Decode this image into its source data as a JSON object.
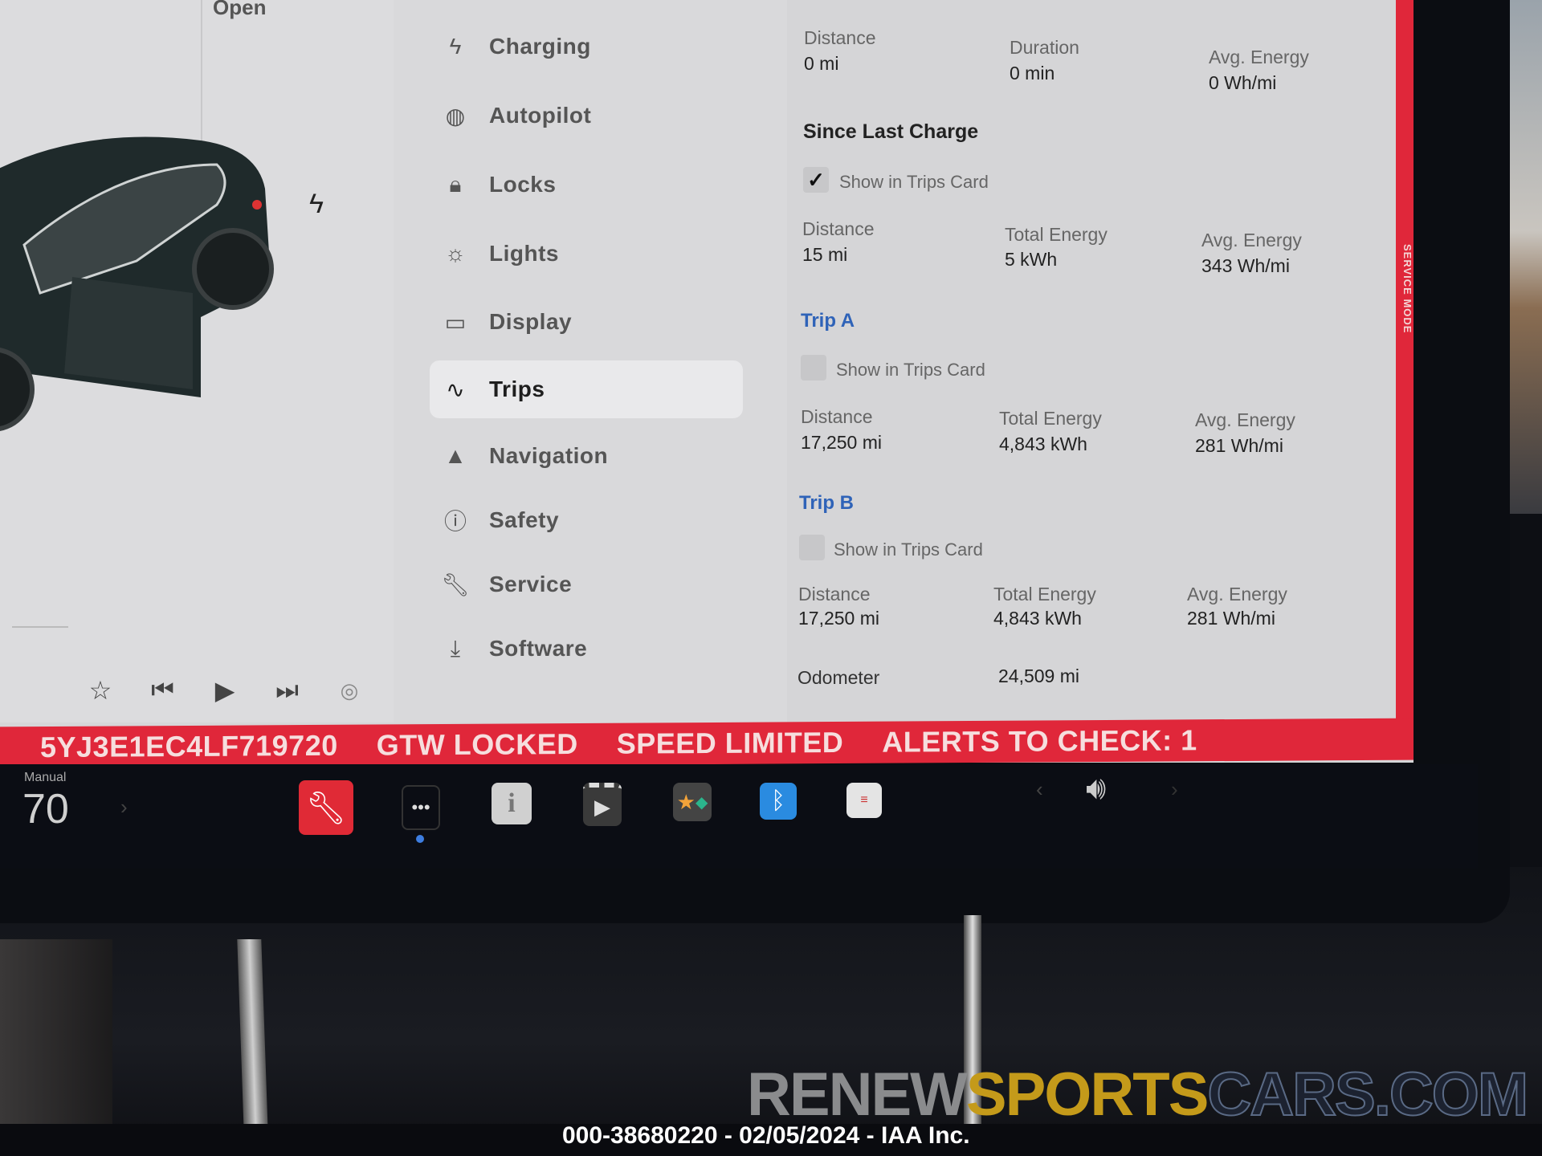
{
  "left_panel": {
    "status_label": "Open",
    "media_controls": [
      "favorite",
      "previous",
      "play",
      "next",
      "radio-source"
    ]
  },
  "sidebar": {
    "items": [
      {
        "label": "Charging",
        "icon": "bolt-icon",
        "active": false
      },
      {
        "label": "Autopilot",
        "icon": "steering-wheel-icon",
        "active": false
      },
      {
        "label": "Locks",
        "icon": "lock-icon",
        "active": false
      },
      {
        "label": "Lights",
        "icon": "light-bulb-icon",
        "active": false
      },
      {
        "label": "Display",
        "icon": "display-icon",
        "active": false
      },
      {
        "label": "Trips",
        "icon": "trips-icon",
        "active": true
      },
      {
        "label": "Navigation",
        "icon": "navigation-arrow-icon",
        "active": false
      },
      {
        "label": "Safety",
        "icon": "alert-circle-icon",
        "active": false
      },
      {
        "label": "Service",
        "icon": "wrench-icon",
        "active": false
      },
      {
        "label": "Software",
        "icon": "download-icon",
        "active": false
      }
    ]
  },
  "content": {
    "current_drive": {
      "cols": [
        {
          "label": "Distance",
          "value": "0 mi"
        },
        {
          "label": "Duration",
          "value": "0 min"
        },
        {
          "label": "Avg. Energy",
          "value": "0 Wh/mi"
        }
      ]
    },
    "since_last_charge": {
      "title": "Since Last Charge",
      "show_in_trips_card": {
        "label": "Show in Trips Card",
        "checked": true
      },
      "cols": [
        {
          "label": "Distance",
          "value": "15 mi"
        },
        {
          "label": "Total Energy",
          "value": "5 kWh"
        },
        {
          "label": "Avg. Energy",
          "value": "343 Wh/mi"
        }
      ]
    },
    "trip_a": {
      "title": "Trip A",
      "show_in_trips_card": {
        "label": "Show in Trips Card",
        "checked": false
      },
      "cols": [
        {
          "label": "Distance",
          "value": "17,250 mi"
        },
        {
          "label": "Total Energy",
          "value": "4,843 kWh"
        },
        {
          "label": "Avg. Energy",
          "value": "281 Wh/mi"
        }
      ]
    },
    "trip_b": {
      "title": "Trip B",
      "show_in_trips_card": {
        "label": "Show in Trips Card",
        "checked": false
      },
      "cols": [
        {
          "label": "Distance",
          "value": "17,250 mi"
        },
        {
          "label": "Total Energy",
          "value": "4,843 kWh"
        },
        {
          "label": "Avg. Energy",
          "value": "281 Wh/mi"
        }
      ]
    },
    "odometer": {
      "label": "Odometer",
      "value": "24,509 mi"
    }
  },
  "service_mode": {
    "side_label": "SERVICE MODE",
    "alerts": [
      "5YJ3E1EC4LF719720",
      "GTW LOCKED",
      "SPEED LIMITED",
      "ALERTS TO CHECK: 1"
    ],
    "color": "#e0273a"
  },
  "taskbar": {
    "climate_mode": "Manual",
    "temperature": "70",
    "apps": [
      "service-app",
      "more-apps",
      "owners-manual",
      "theater",
      "toybox",
      "bluetooth",
      "calendar"
    ],
    "volume_icon": "speaker-volume-icon"
  },
  "watermark": {
    "part1": "RENEW",
    "part2": "SPORTS",
    "part3": "CARS.COM",
    "caption": "000-38680220 - 02/05/2024 - IAA Inc."
  }
}
